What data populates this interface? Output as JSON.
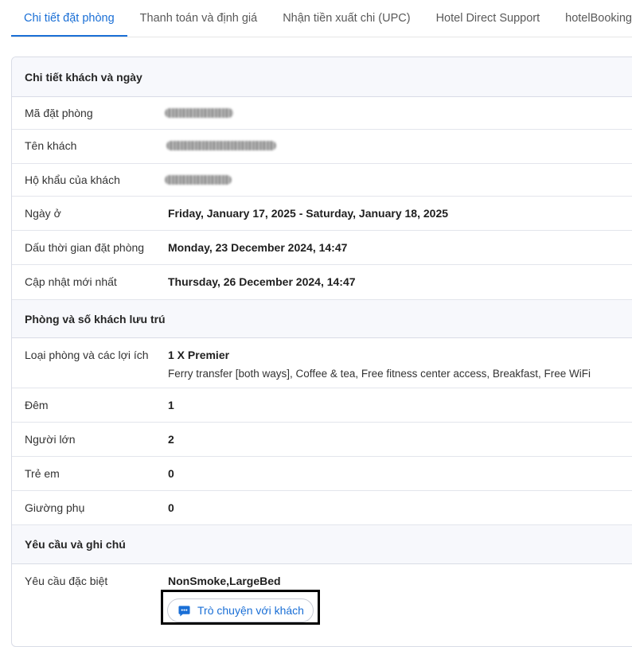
{
  "tabs": [
    {
      "label": "Chi tiết đặt phòng",
      "active": true
    },
    {
      "label": "Thanh toán và định giá"
    },
    {
      "label": "Nhận tiền xuất chi (UPC)"
    },
    {
      "label": "Hotel Direct Support"
    },
    {
      "label": "hotelBookingp"
    }
  ],
  "sections": {
    "guest": "Chi tiết khách và ngày",
    "rooms": "Phòng và số khách lưu trú",
    "requests": "Yêu cầu và ghi chú"
  },
  "guest_details": {
    "booking_code_label": "Mã đặt phòng",
    "guest_name_label": "Tên khách",
    "residence_label": "Hộ khẩu của khách",
    "stay_label": "Ngày ở",
    "stay_value": "Friday, January 17, 2025 - Saturday, January 18, 2025",
    "booked_at_label": "Dấu thời gian đặt phòng",
    "booked_at_value": "Monday, 23 December 2024, 14:47",
    "updated_label": "Cập nhật mới nhất",
    "updated_value": "Thursday, 26 December 2024, 14:47"
  },
  "room_details": {
    "room_type_label": "Loại phòng và các lợi ích",
    "room_type_value": "1 X Premier",
    "benefits": "Ferry transfer [both ways], Coffee & tea, Free fitness center access, Breakfast, Free WiFi",
    "nights_label": "Đêm",
    "nights_value": "1",
    "adults_label": "Người lớn",
    "adults_value": "2",
    "children_label": "Trẻ em",
    "children_value": "0",
    "extra_beds_label": "Giường phụ",
    "extra_beds_value": "0"
  },
  "requests": {
    "special_label": "Yêu cầu đặc biệt",
    "special_value": "NonSmoke,LargeBed",
    "chat_button": "Trò chuyện với khách"
  },
  "colors": {
    "accent": "#1a6fd6",
    "section_bg": "#f7f8fc",
    "border": "#d9dce6"
  },
  "icons": {
    "chat": "chat-bubble-icon"
  }
}
